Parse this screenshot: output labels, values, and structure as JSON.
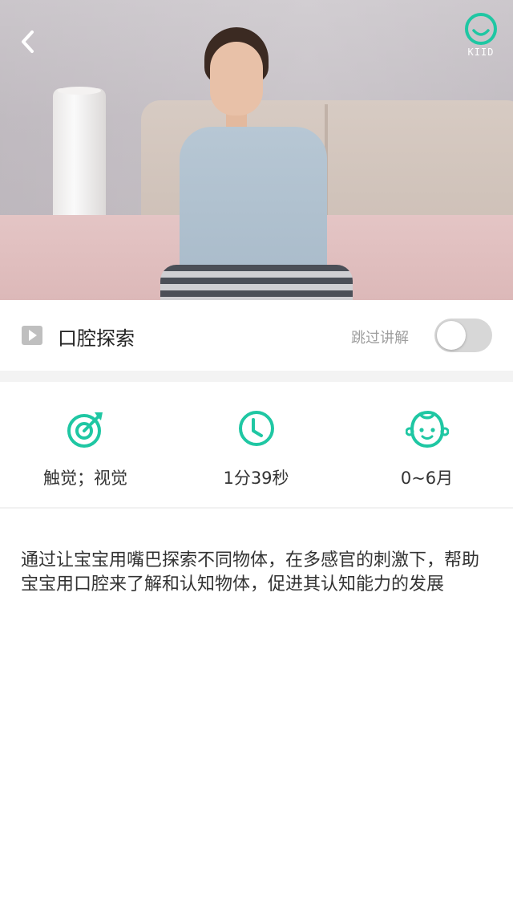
{
  "video": {
    "logo_text": "KIID"
  },
  "lesson": {
    "title": "口腔探索",
    "skip_label": "跳过讲解",
    "skip_enabled": false
  },
  "info": {
    "senses": "触觉；视觉",
    "duration": "1分39秒",
    "age": "0~6月"
  },
  "description": "通过让宝宝用嘴巴探索不同物体，在多感官的刺激下，帮助宝宝用口腔来了解和认知物体，促进其认知能力的发展",
  "colors": {
    "accent": "#1fc7a3",
    "toggle_off": "#d7d7d7"
  },
  "icons": [
    "back-icon",
    "kiid-logo-icon",
    "play-icon",
    "target-icon",
    "clock-icon",
    "baby-face-icon"
  ]
}
